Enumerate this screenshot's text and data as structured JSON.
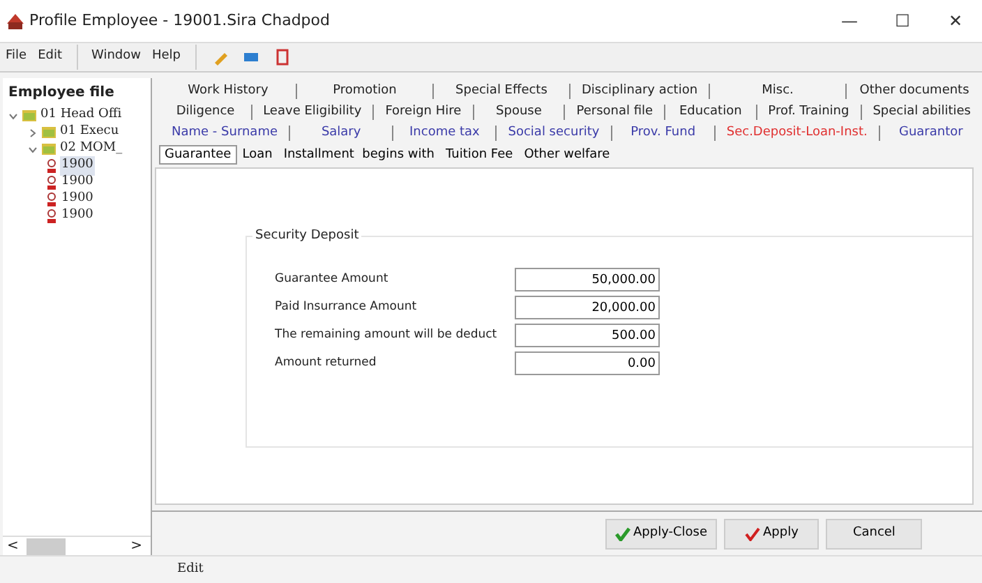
{
  "window": {
    "title": "Profile Employee - 19001.Sira Chadpod",
    "controls": [
      "—",
      "☐",
      "✕"
    ]
  },
  "menu": [
    "File",
    "Edit",
    "Window",
    "Help"
  ],
  "sidebar": {
    "title": "Employee file",
    "tree": [
      {
        "label": "01 Head Offi",
        "expanded": true,
        "selected": false,
        "children": [
          {
            "label": "01 Execu",
            "expanded": false,
            "selected": false
          },
          {
            "label": "02 MOM_",
            "expanded": true,
            "selected": false,
            "children": [
              {
                "label": "1900",
                "selected": true
              },
              {
                "label": "1900",
                "selected": false
              },
              {
                "label": "1900",
                "selected": false
              },
              {
                "label": "1900",
                "selected": false
              }
            ]
          }
        ]
      }
    ],
    "scroll_left": "<",
    "scroll_right": ">"
  },
  "tab_rows": [
    [
      {
        "label": "Work History",
        "selected": false
      },
      {
        "label": "Promotion",
        "selected": false
      },
      {
        "label": "Special Effects",
        "selected": false
      },
      {
        "label": "Disciplinary action",
        "selected": false
      },
      {
        "label": "Misc.",
        "selected": false
      },
      {
        "label": "Other documents",
        "selected": false
      }
    ],
    [
      {
        "label": "Diligence",
        "selected": false
      },
      {
        "label": "Leave Eligibility",
        "selected": false
      },
      {
        "label": "Foreign Hire",
        "selected": false
      },
      {
        "label": "Spouse",
        "selected": false
      },
      {
        "label": "Personal file",
        "selected": false
      },
      {
        "label": "Education",
        "selected": false
      },
      {
        "label": "Prof. Training",
        "selected": false
      },
      {
        "label": "Special abilities",
        "selected": false
      }
    ],
    [
      {
        "label": "Name - Surname",
        "selected": false
      },
      {
        "label": "Salary",
        "selected": false
      },
      {
        "label": "Income tax",
        "selected": false
      },
      {
        "label": "Social security",
        "selected": false
      },
      {
        "label": "Prov. Fund",
        "selected": false
      },
      {
        "label": "Sec.Deposit-Loan-Inst.",
        "selected": true
      },
      {
        "label": "Guarantor",
        "selected": false
      }
    ]
  ],
  "sub_tabs": [
    {
      "label": "Guarantee",
      "selected": true
    },
    {
      "label": "Loan",
      "selected": false
    },
    {
      "label": "Installment  begins with",
      "selected": false
    },
    {
      "label": "Tuition Fee",
      "selected": false
    },
    {
      "label": "Other welfare",
      "selected": false
    }
  ],
  "group": {
    "title": "Security Deposit",
    "fields": [
      {
        "label": "Guarantee Amount",
        "value": "50,000.00"
      },
      {
        "label": "Paid Insurrance Amount",
        "value": "20,000.00"
      },
      {
        "label": "The remaining amount will be deduct",
        "value": "500.00"
      },
      {
        "label": "Amount returned",
        "value": "0.00"
      }
    ]
  },
  "buttons": [
    {
      "label": "Apply-Close",
      "kind": "apply-close"
    },
    {
      "label": "Apply",
      "kind": "apply"
    },
    {
      "label": "Cancel",
      "kind": "cancel"
    }
  ],
  "status_bar": "Edit"
}
